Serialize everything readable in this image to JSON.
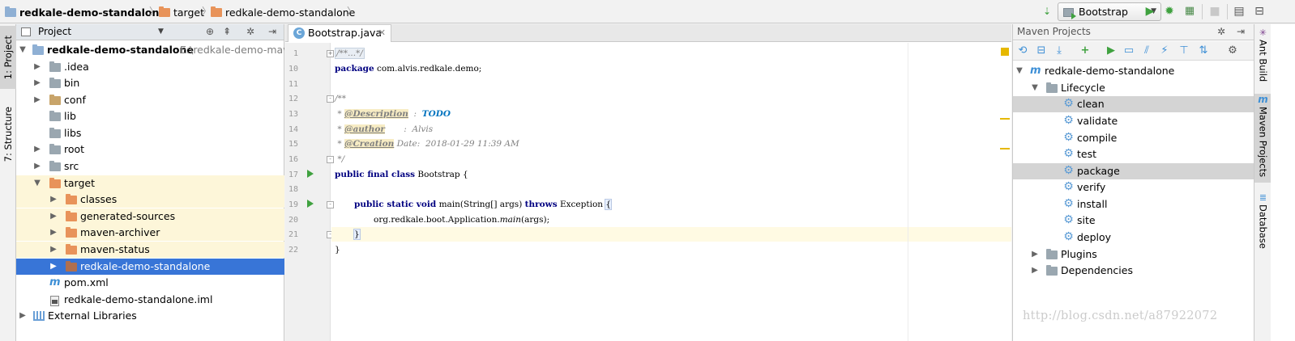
{
  "navbar": {
    "crumbs": [
      {
        "label": "redkale-demo-standalone",
        "icon": "project-folder-icon"
      },
      {
        "label": "target",
        "icon": "folder-icon"
      },
      {
        "label": "redkale-demo-standalone",
        "icon": "folder-icon"
      }
    ],
    "run_config": "Bootstrap"
  },
  "left_stripe": {
    "tabs": [
      "1: Project",
      "7: Structure"
    ]
  },
  "project_panel": {
    "title": "Project",
    "root": {
      "label": "redkale-demo-standalone",
      "path": "E:\\redkale-demo-maven"
    },
    "items": [
      {
        "label": ".idea"
      },
      {
        "label": "bin"
      },
      {
        "label": "conf"
      },
      {
        "label": "lib"
      },
      {
        "label": "libs"
      },
      {
        "label": "root"
      },
      {
        "label": "src"
      },
      {
        "label": "target"
      },
      {
        "label": "classes"
      },
      {
        "label": "generated-sources"
      },
      {
        "label": "maven-archiver"
      },
      {
        "label": "maven-status"
      },
      {
        "label": "redkale-demo-standalone"
      },
      {
        "label": "pom.xml"
      },
      {
        "label": "redkale-demo-standalone.iml"
      },
      {
        "label": "External Libraries"
      }
    ]
  },
  "editor": {
    "tab_label": "Bootstrap.java",
    "line_numbers": [
      "1",
      "10",
      "11",
      "12",
      "13",
      "14",
      "15",
      "16",
      "17",
      "18",
      "19",
      "20",
      "21",
      "22"
    ],
    "code": {
      "l1_folded": "/**...*/",
      "l10_kw": "package",
      "l10_rest": " com.alvis.redkale.demo;",
      "l12": "/**",
      "l13_star": " * ",
      "l13_tag": "@Description",
      "l13_sep": "  :  ",
      "l13_todo": "TODO",
      "l14_star": " * ",
      "l14_tag": "@author",
      "l14_rest": "       :  Alvis",
      "l15_star": " * ",
      "l15_tag": "@Creation",
      "l15_rest": " Date:  2018-01-29 11:39 AM",
      "l16": " */",
      "l17_kw": "public final class",
      "l17_rest": " Bootstrap {",
      "l19_kw1": "public static void",
      "l19_mid": " main(String[] args) ",
      "l19_kw2": "throws",
      "l19_rest": " Exception ",
      "l19_brace": "{",
      "l20_a": "org.redkale.boot.Application.",
      "l20_b": "main",
      "l20_c": "(args);",
      "l21": "}",
      "l22": "}"
    }
  },
  "maven_panel": {
    "title": "Maven Projects",
    "project": "redkale-demo-standalone",
    "lifecycle_label": "Lifecycle",
    "phases": [
      "clean",
      "validate",
      "compile",
      "test",
      "package",
      "verify",
      "install",
      "site",
      "deploy"
    ],
    "selected_phases": [
      "clean",
      "package"
    ],
    "plugins_label": "Plugins",
    "dependencies_label": "Dependencies"
  },
  "right_stripe": {
    "tabs": [
      "Ant Build",
      "Maven Projects",
      "Database"
    ]
  },
  "watermark": "http://blog.csdn.net/a87922072",
  "colors": {
    "selection": "#3875d7",
    "highlight_row": "#fdf6d9",
    "keyword": "#000080",
    "run_green": "#3fa13f"
  }
}
